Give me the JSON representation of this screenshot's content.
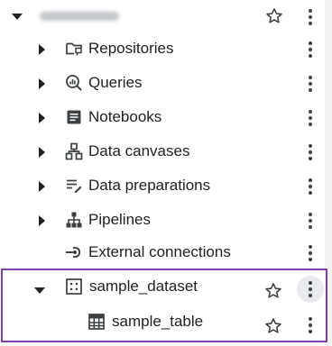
{
  "project": {
    "name_hidden": true
  },
  "items": [
    {
      "label": "Repositories",
      "icon": "repository-icon"
    },
    {
      "label": "Queries",
      "icon": "query-icon"
    },
    {
      "label": "Notebooks",
      "icon": "notebook-icon"
    },
    {
      "label": "Data canvases",
      "icon": "data-canvas-icon"
    },
    {
      "label": "Data preparations",
      "icon": "data-preparation-icon"
    },
    {
      "label": "Pipelines",
      "icon": "pipeline-icon"
    },
    {
      "label": "External connections",
      "icon": "external-connection-icon"
    }
  ],
  "dataset": {
    "label": "sample_dataset",
    "icon": "dataset-icon"
  },
  "table": {
    "label": "sample_table",
    "icon": "table-icon"
  },
  "colors": {
    "highlight": "#7b3fa7",
    "text": "#202124",
    "icon": "#3c4043"
  }
}
